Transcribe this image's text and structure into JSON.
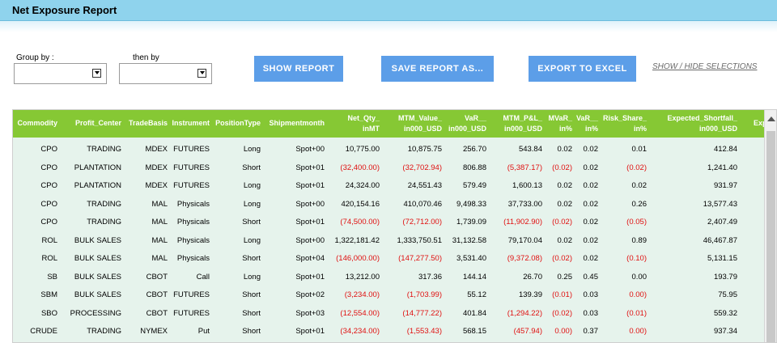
{
  "title": "Net Exposure Report",
  "filters": {
    "group_by_label": "Group by :",
    "then_by_label": "then by",
    "group_by_value": "",
    "then_by_value": ""
  },
  "buttons": {
    "show_report": "SHOW REPORT",
    "save_report_as": "SAVE REPORT AS...",
    "export_to_excel": "EXPORT TO EXCEL",
    "show_hide_selections": "SHOW / HIDE SELECTIONS"
  },
  "colors": {
    "title_bar": "#8fd3ed",
    "button": "#5c9ee8",
    "grid_header": "#86c834",
    "row_background": "#e6f3ec",
    "negative_value": "#e01010"
  },
  "table": {
    "columns": [
      {
        "l1": "Commodity",
        "l2": ""
      },
      {
        "l1": "Profit_Center",
        "l2": ""
      },
      {
        "l1": "TradeBasis",
        "l2": ""
      },
      {
        "l1": "Instrument",
        "l2": ""
      },
      {
        "l1": "PositionType",
        "l2": ""
      },
      {
        "l1": "Shipmentmonth",
        "l2": ""
      },
      {
        "l1": "Net_Qty_",
        "l2": "inMT"
      },
      {
        "l1": "MTM_Value_",
        "l2": "in000_USD"
      },
      {
        "l1": "VaR__",
        "l2": "in000_USD"
      },
      {
        "l1": "MTM_P&L_",
        "l2": "in000_USD"
      },
      {
        "l1": "MVaR_",
        "l2": "in%"
      },
      {
        "l1": "VaR__",
        "l2": "in%"
      },
      {
        "l1": "Risk_Share_",
        "l2": "in%"
      },
      {
        "l1": "Expected_Shortfall_",
        "l2": "in000_USD"
      },
      {
        "l1": "Expec",
        "l2": ""
      }
    ],
    "rows": [
      [
        "CPO",
        "TRADING",
        "MDEX",
        "FUTURES",
        "Long",
        "Spot+00",
        "10,775.00",
        "10,875.75",
        "256.70",
        "543.84",
        "0.02",
        "0.02",
        "0.01",
        "412.84"
      ],
      [
        "CPO",
        "PLANTATION",
        "MDEX",
        "FUTURES",
        "Short",
        "Spot+01",
        "(32,400.00)",
        "(32,702.94)",
        "806.88",
        "(5,387.17)",
        "(0.02)",
        "0.02",
        "(0.02)",
        "1,241.40"
      ],
      [
        "CPO",
        "PLANTATION",
        "MDEX",
        "FUTURES",
        "Long",
        "Spot+01",
        "24,324.00",
        "24,551.43",
        "579.49",
        "1,600.13",
        "0.02",
        "0.02",
        "0.02",
        "931.97"
      ],
      [
        "CPO",
        "TRADING",
        "MAL",
        "Physicals",
        "Long",
        "Spot+00",
        "420,154.16",
        "410,070.46",
        "9,498.33",
        "37,733.00",
        "0.02",
        "0.02",
        "0.26",
        "13,577.43"
      ],
      [
        "CPO",
        "TRADING",
        "MAL",
        "Physicals",
        "Short",
        "Spot+01",
        "(74,500.00)",
        "(72,712.00)",
        "1,739.09",
        "(11,902.90)",
        "(0.02)",
        "0.02",
        "(0.05)",
        "2,407.49"
      ],
      [
        "ROL",
        "BULK SALES",
        "MAL",
        "Physicals",
        "Long",
        "Spot+00",
        "1,322,181.42",
        "1,333,750.51",
        "31,132.58",
        "79,170.04",
        "0.02",
        "0.02",
        "0.89",
        "46,467.87"
      ],
      [
        "ROL",
        "BULK SALES",
        "MAL",
        "Physicals",
        "Short",
        "Spot+04",
        "(146,000.00)",
        "(147,277.50)",
        "3,531.40",
        "(9,372.08)",
        "(0.02)",
        "0.02",
        "(0.10)",
        "5,131.15"
      ],
      [
        "SB",
        "BULK SALES",
        "CBOT",
        "Call",
        "Long",
        "Spot+01",
        "13,212.00",
        "317.36",
        "144.14",
        "26.70",
        "0.25",
        "0.45",
        "0.00",
        "193.79"
      ],
      [
        "SBM",
        "BULK SALES",
        "CBOT",
        "FUTURES",
        "Short",
        "Spot+02",
        "(3,234.00)",
        "(1,703.99)",
        "55.12",
        "139.39",
        "(0.01)",
        "0.03",
        "0.00)",
        "75.95"
      ],
      [
        "SBO",
        "PROCESSING",
        "CBOT",
        "FUTURES",
        "Short",
        "Spot+03",
        "(12,554.00)",
        "(14,777.22)",
        "401.84",
        "(1,294.22)",
        "(0.02)",
        "0.03",
        "(0.01)",
        "559.32"
      ],
      [
        "CRUDE",
        "TRADING",
        "NYMEX",
        "Put",
        "Short",
        "Spot+01",
        "(34,234.00)",
        "(1,553.43)",
        "568.15",
        "(457.94)",
        "0.00)",
        "0.37",
        "0.00)",
        "937.34"
      ]
    ]
  }
}
